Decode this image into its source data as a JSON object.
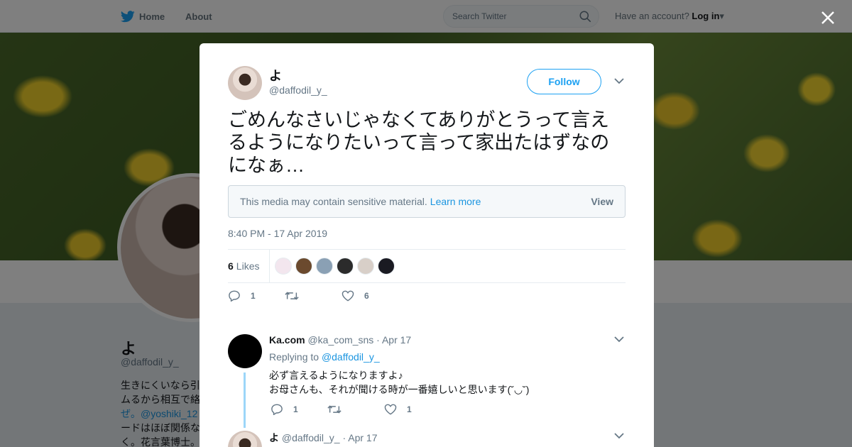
{
  "nav": {
    "home_label": "Home",
    "about_label": "About",
    "search_placeholder": "Search Twitter",
    "account_prompt": "Have an account?",
    "login_label": "Log in"
  },
  "background_profile": {
    "name": "よ",
    "handle": "@daffodil_y_",
    "bio_lines": [
      "生きにくいなら引",
      "ムるから相互で絡",
      "ぜ。@yoshiki_12",
      "ードはほぼ関係な",
      "く。花言葉博士。"
    ]
  },
  "tweet": {
    "author_name": "よ",
    "author_handle": "@daffodil_y_",
    "follow_label": "Follow",
    "text": "ごめんなさいじゃなくてありがとうって言えるようになりたいって言って家出たはずなのになぁ…",
    "sensitive_text": "This media may contain sensitive material.",
    "learn_more": "Learn more",
    "view_label": "View",
    "timestamp": "8:40 PM - 17 Apr 2019",
    "likes_count": "6",
    "likes_label": "Likes",
    "reply_count": "1",
    "like_count": "6"
  },
  "likers": [
    "#f3e6ee",
    "#6b4a2e",
    "#8aa0b4",
    "#2b2b2b",
    "#d8cfc8",
    "#1a1a22"
  ],
  "replies": [
    {
      "name": "Ka.com",
      "handle": "@ka_com_sns",
      "date": "· Apr 17",
      "replying_prefix": "Replying to",
      "replying_to": "@daffodil_y_",
      "text": "必ず言えるようになりますよ♪\nお母さんも、それが聞ける時が一番嬉しいと思います(˘◡˘)",
      "reply_count": "1",
      "like_count": "1"
    },
    {
      "name": "よ",
      "handle": "@daffodil_y_",
      "date": "· Apr 17"
    }
  ],
  "colors": {
    "accent": "#1da1f2",
    "link": "#1b95e0",
    "muted": "#657786"
  }
}
